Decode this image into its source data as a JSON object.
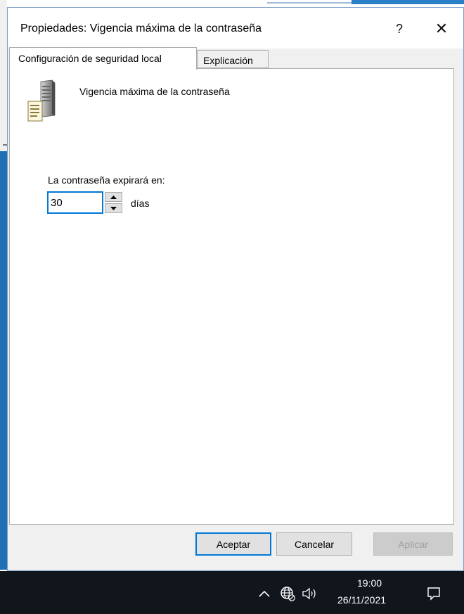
{
  "dialog": {
    "title": "Propiedades: Vigencia máxima de la contraseña",
    "help_glyph": "?",
    "close_glyph": "✕"
  },
  "tabs": [
    {
      "label": "Configuración de seguridad local",
      "active": true
    },
    {
      "label": "Explicación",
      "active": false
    }
  ],
  "policy": {
    "icon": "server-policy-icon",
    "name": "Vigencia máxima de la contraseña",
    "expire_label": "La contraseña expirará en:",
    "value": "30",
    "unit": "días"
  },
  "buttons": {
    "ok": "Aceptar",
    "cancel": "Cancelar",
    "apply": "Aplicar"
  },
  "taskbar": {
    "time": "19:00",
    "date": "26/11/2021"
  },
  "colors": {
    "accent": "#0078d7",
    "taskbar": "#11151c"
  }
}
